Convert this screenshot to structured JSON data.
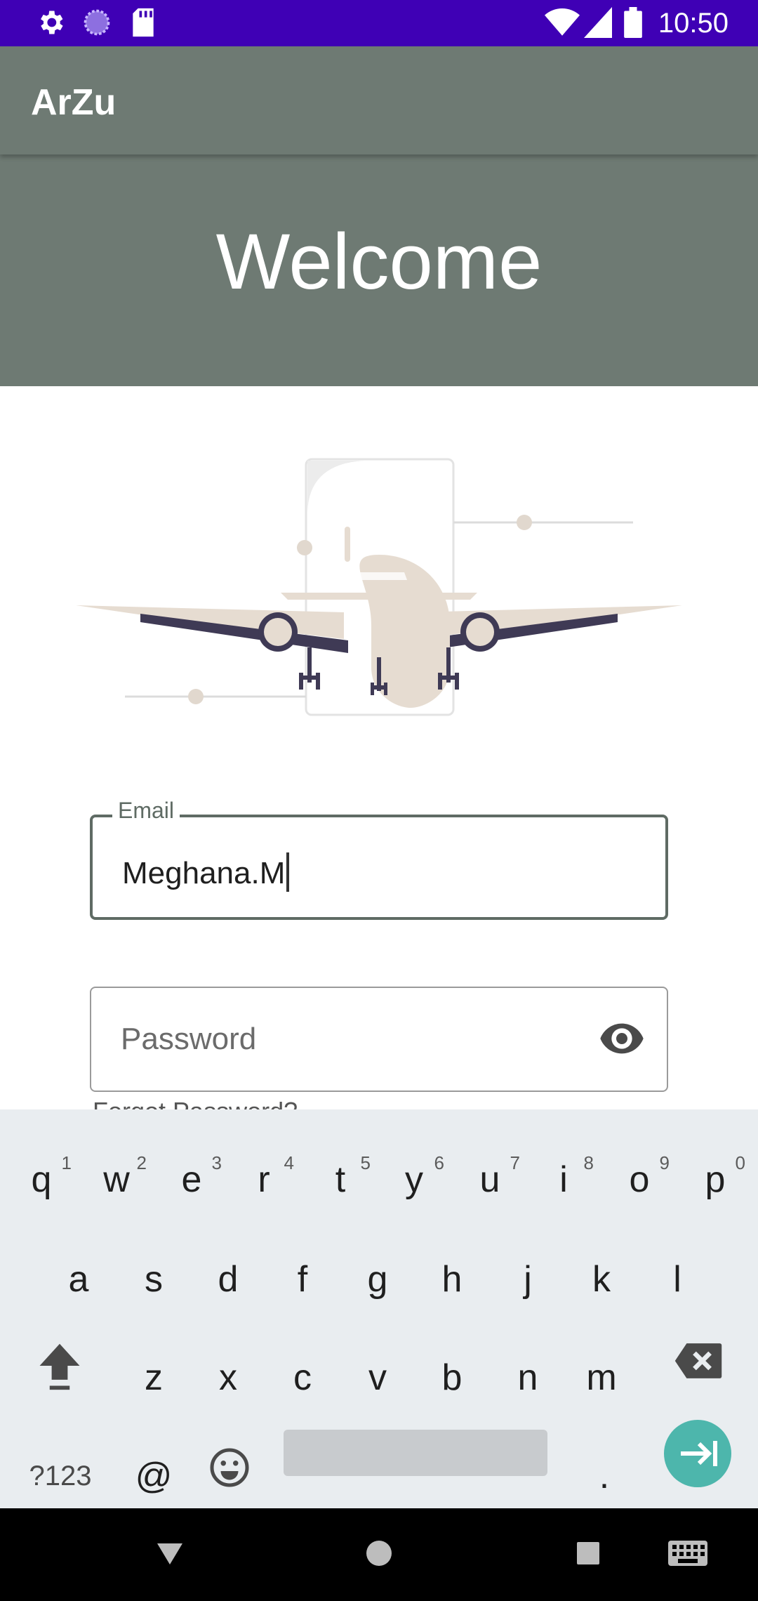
{
  "status_bar": {
    "time": "10:50",
    "left_icons": [
      "gear-icon",
      "spinner-icon",
      "sd-card-icon"
    ],
    "right_icons": [
      "wifi-icon",
      "signal-icon",
      "battery-icon"
    ]
  },
  "app_bar": {
    "title": "ArZu"
  },
  "hero": {
    "title": "Welcome"
  },
  "illustration": {
    "name": "airplane-illustration"
  },
  "email_field": {
    "label": "Email",
    "value": "Meghana.M"
  },
  "password_field": {
    "placeholder": "Password",
    "toggle_icon": "eye-icon"
  },
  "forgot_password": {
    "label": "Forgot Password?"
  },
  "keyboard": {
    "row1": [
      {
        "key": "q",
        "num": "1"
      },
      {
        "key": "w",
        "num": "2"
      },
      {
        "key": "e",
        "num": "3"
      },
      {
        "key": "r",
        "num": "4"
      },
      {
        "key": "t",
        "num": "5"
      },
      {
        "key": "y",
        "num": "6"
      },
      {
        "key": "u",
        "num": "7"
      },
      {
        "key": "i",
        "num": "8"
      },
      {
        "key": "o",
        "num": "9"
      },
      {
        "key": "p",
        "num": "0"
      }
    ],
    "row2": [
      "a",
      "s",
      "d",
      "f",
      "g",
      "h",
      "j",
      "k",
      "l"
    ],
    "row3": [
      "z",
      "x",
      "c",
      "v",
      "b",
      "n",
      "m"
    ],
    "symbols_label": "?123",
    "at_label": "@",
    "period_label": ".",
    "enter_color": "#4db6ac"
  },
  "nav_bar": {
    "icons": [
      "back-icon",
      "home-icon",
      "recents-icon",
      "keyboard-switch-icon"
    ]
  }
}
